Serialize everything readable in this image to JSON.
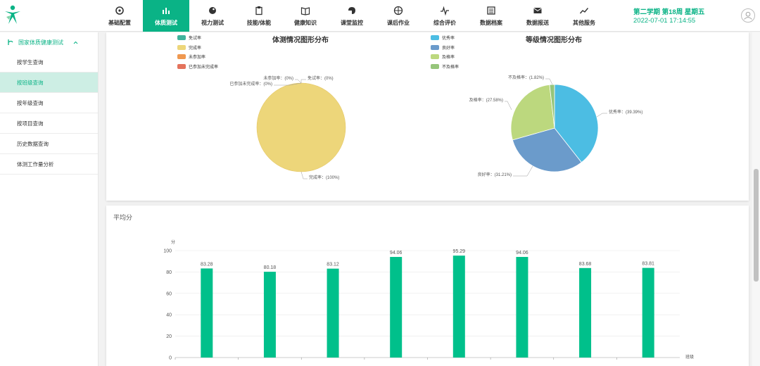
{
  "colors": {
    "accent": "#0ab386",
    "bar": "#00c08b"
  },
  "header": {
    "nav": [
      {
        "label": "基础配置",
        "icon": "gear-icon"
      },
      {
        "label": "体质测试",
        "icon": "bar-chart-icon",
        "active": true
      },
      {
        "label": "视力测试",
        "icon": "eye-icon"
      },
      {
        "label": "技能/体能",
        "icon": "clipboard-icon"
      },
      {
        "label": "健康知识",
        "icon": "book-icon"
      },
      {
        "label": "课堂监控",
        "icon": "monitor-icon"
      },
      {
        "label": "课后作业",
        "icon": "ball-icon"
      },
      {
        "label": "综合评价",
        "icon": "pulse-icon"
      },
      {
        "label": "数据档案",
        "icon": "archive-icon"
      },
      {
        "label": "数据报送",
        "icon": "mail-icon"
      },
      {
        "label": "其他服务",
        "icon": "trend-icon"
      }
    ],
    "term": "第二学期 第18周 星期五",
    "datetime": "2022-07-01 17:14:55"
  },
  "sidebar": {
    "section": "国家体质健康测试",
    "items": [
      {
        "label": "按学生查询"
      },
      {
        "label": "按班级查询",
        "active": true
      },
      {
        "label": "按年级查询"
      },
      {
        "label": "按项目查询"
      },
      {
        "label": "历史数据查询"
      },
      {
        "label": "体测工作量分析"
      }
    ]
  },
  "chart_data": [
    {
      "type": "pie",
      "title": "体测情况图形分布",
      "legend_placement": "top-left",
      "labels": [
        "免试率",
        "完成率",
        "未参加率",
        "已参加未完成率"
      ],
      "values": [
        0,
        100,
        0,
        0
      ],
      "colors": [
        "#3fb39c",
        "#edd67a",
        "#ef9850",
        "#e4735c"
      ],
      "data_labels": [
        "免试率：(0%)",
        "完成率：(100%)",
        "未参加率：(0%)",
        "已参加未完成率：(0%)"
      ]
    },
    {
      "type": "pie",
      "title": "等级情况图形分布",
      "legend_placement": "top-left",
      "labels": [
        "优秀率",
        "良好率",
        "及格率",
        "不及格率"
      ],
      "values": [
        39.39,
        31.21,
        27.58,
        1.82
      ],
      "colors": [
        "#4cbde3",
        "#6b9bcb",
        "#bcd87e",
        "#96c57a"
      ],
      "data_labels": [
        "优秀率：(39.39%)",
        "良好率：(31.21%)",
        "及格率：(27.58%)",
        "不及格率：(1.82%)"
      ]
    },
    {
      "type": "bar",
      "title": "平均分",
      "ylabel": "分",
      "xlabel": "班级",
      "ylim": [
        0,
        100
      ],
      "yticks": [
        0,
        20,
        40,
        60,
        80,
        100
      ],
      "grid": true,
      "values": [
        83.28,
        80.18,
        83.12,
        94.06,
        95.29,
        94.06,
        83.68,
        83.81
      ],
      "data_labels": [
        "83.28",
        "80.18",
        "83.12",
        "94.06",
        "95.29",
        "94.06",
        "83.68",
        "83.81"
      ]
    }
  ]
}
